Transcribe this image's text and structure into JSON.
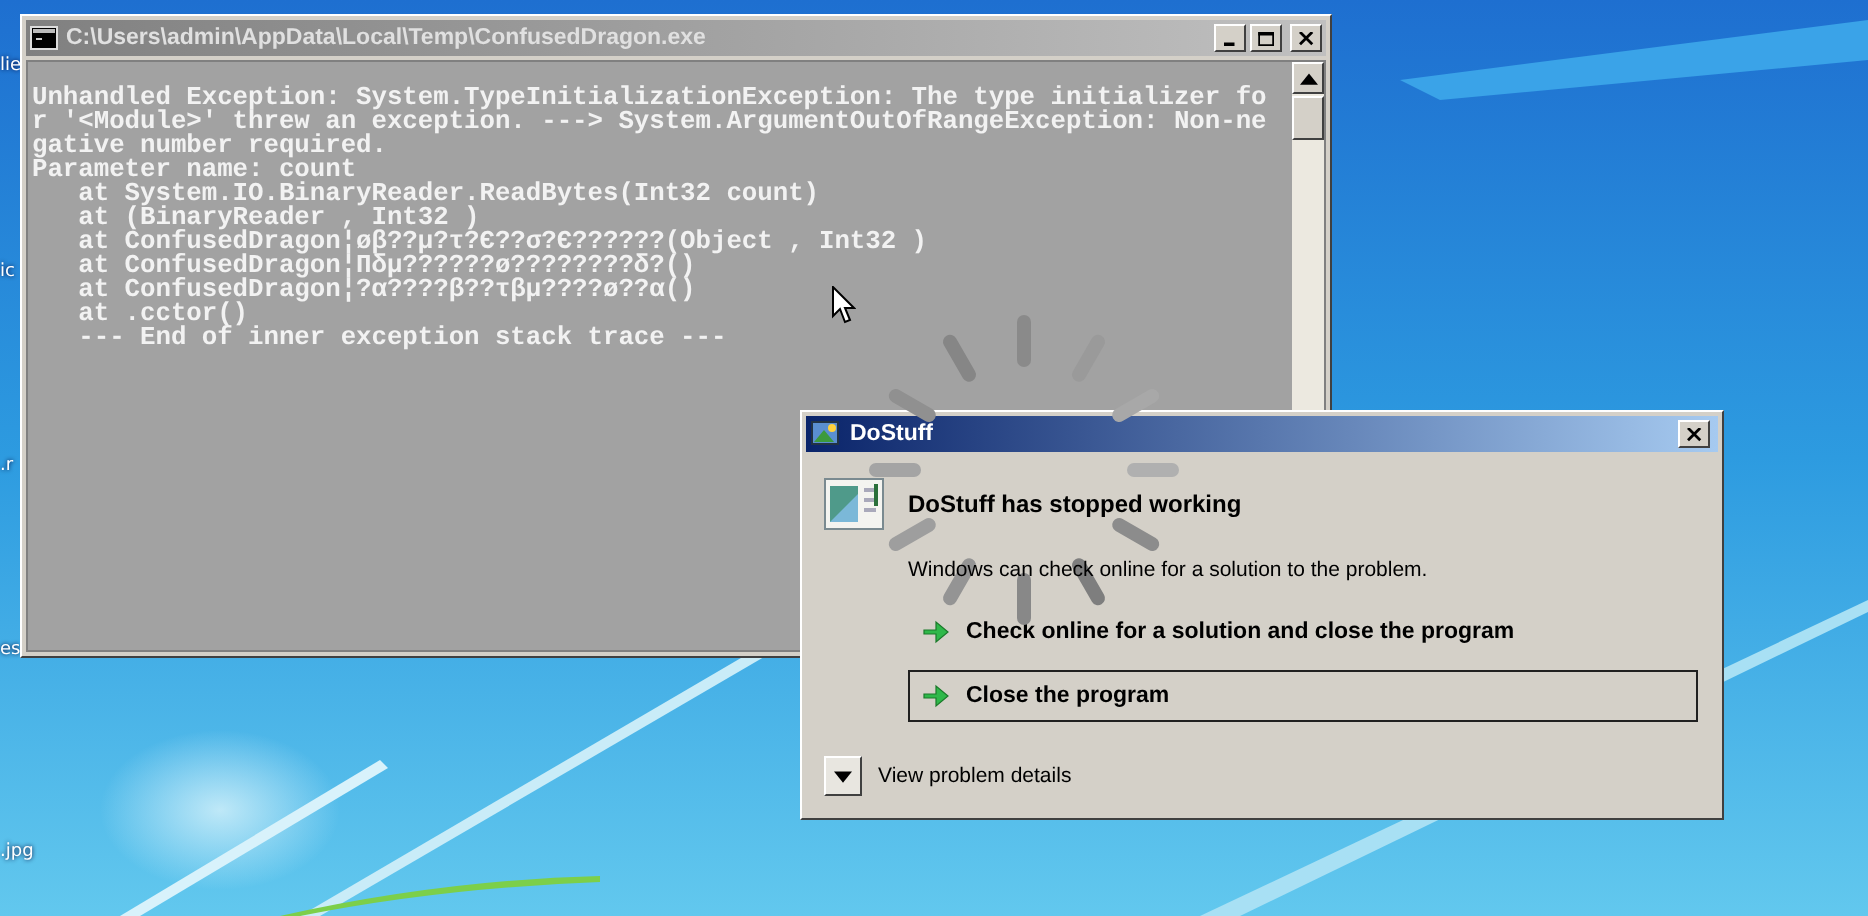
{
  "desktop": {
    "icons": [
      {
        "label": "lie"
      },
      {
        "label": "ic"
      },
      {
        "label": ".r"
      },
      {
        "label": "es"
      },
      {
        "label": ".jpg"
      }
    ]
  },
  "console_window": {
    "title": "C:\\Users\\admin\\AppData\\Local\\Temp\\ConfusedDragon.exe",
    "lines": [
      "Unhandled Exception: System.TypeInitializationException: The type initializer fo",
      "r '<Module>' threw an exception. ---> System.ArgumentOutOfRangeException: Non-ne",
      "gative number required.",
      "Parameter name: count",
      "   at System.IO.BinaryReader.ReadBytes(Int32 count)",
      "   at (BinaryReader , Int32 )",
      "   at ConfusedDragon¦øβ??µ?τ?Є??σ?Є??????(Object , Int32 )",
      "   at ConfusedDragon¦Πδµ??????ø????????δ?()",
      "   at ConfusedDragon¦?α????β??τβµ????ø??α()",
      "   at .cctor()",
      "   --- End of inner exception stack trace ---"
    ]
  },
  "dialog": {
    "title": "DoStuff",
    "heading": "DoStuff has stopped working",
    "message": "Windows can check online for a solution to the problem.",
    "options": [
      {
        "label": "Check online for a solution and close the program",
        "selected": false
      },
      {
        "label": "Close the program",
        "selected": true
      }
    ],
    "details_toggle": {
      "label": "View problem details",
      "expanded": false
    }
  }
}
